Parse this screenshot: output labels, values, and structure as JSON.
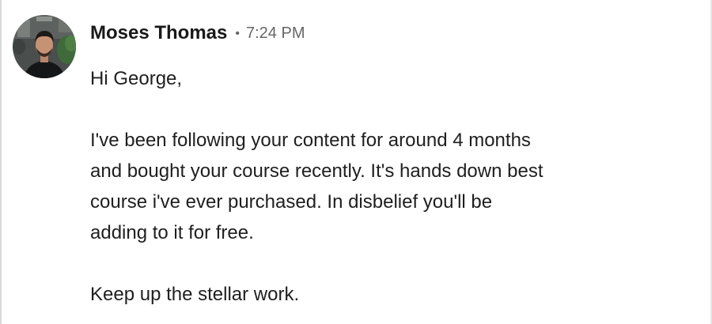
{
  "message": {
    "sender_name": "Moses Thomas",
    "separator": "•",
    "timestamp": "7:24 PM",
    "avatar_icon": "profile-photo-icon",
    "greeting": "Hi George,",
    "paragraph_lines": [
      "I've been following your content for around 4 months",
      "and bought your course recently. It's hands down best",
      "course i've ever purchased. In disbelief you'll be",
      "adding to it for free."
    ],
    "closing": "Keep up the stellar work."
  },
  "colors": {
    "name": "#191919",
    "meta": "#666666",
    "text": "#1f1f1f"
  }
}
